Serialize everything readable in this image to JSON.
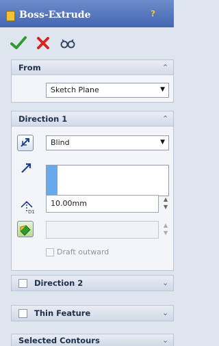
{
  "window": {
    "title": "Boss-Extrude",
    "help_label": "?",
    "title_icon": "extrude-feature-icon"
  },
  "toolbar": {
    "ok_icon": "checkmark-icon",
    "cancel_icon": "cross-icon",
    "preview_icon": "detailed-preview-icon"
  },
  "from": {
    "title": "From",
    "value": "Sketch Plane"
  },
  "direction1": {
    "title": "Direction 1",
    "end_condition": "Blind",
    "depth": "10.00mm",
    "draft_label": "Draft outward",
    "icons": [
      "reverse-direction-icon",
      "direction-arrow-icon",
      "depth-icon",
      "draft-icon"
    ]
  },
  "direction2": {
    "title": "Direction 2"
  },
  "thin_feature": {
    "title": "Thin Feature"
  },
  "selected_contours": {
    "title": "Selected Contours"
  },
  "colors": {
    "titlebar": "#4566b0",
    "accent": "#6aa8ec",
    "ok": "#2d9b2d",
    "cancel": "#d42424"
  }
}
